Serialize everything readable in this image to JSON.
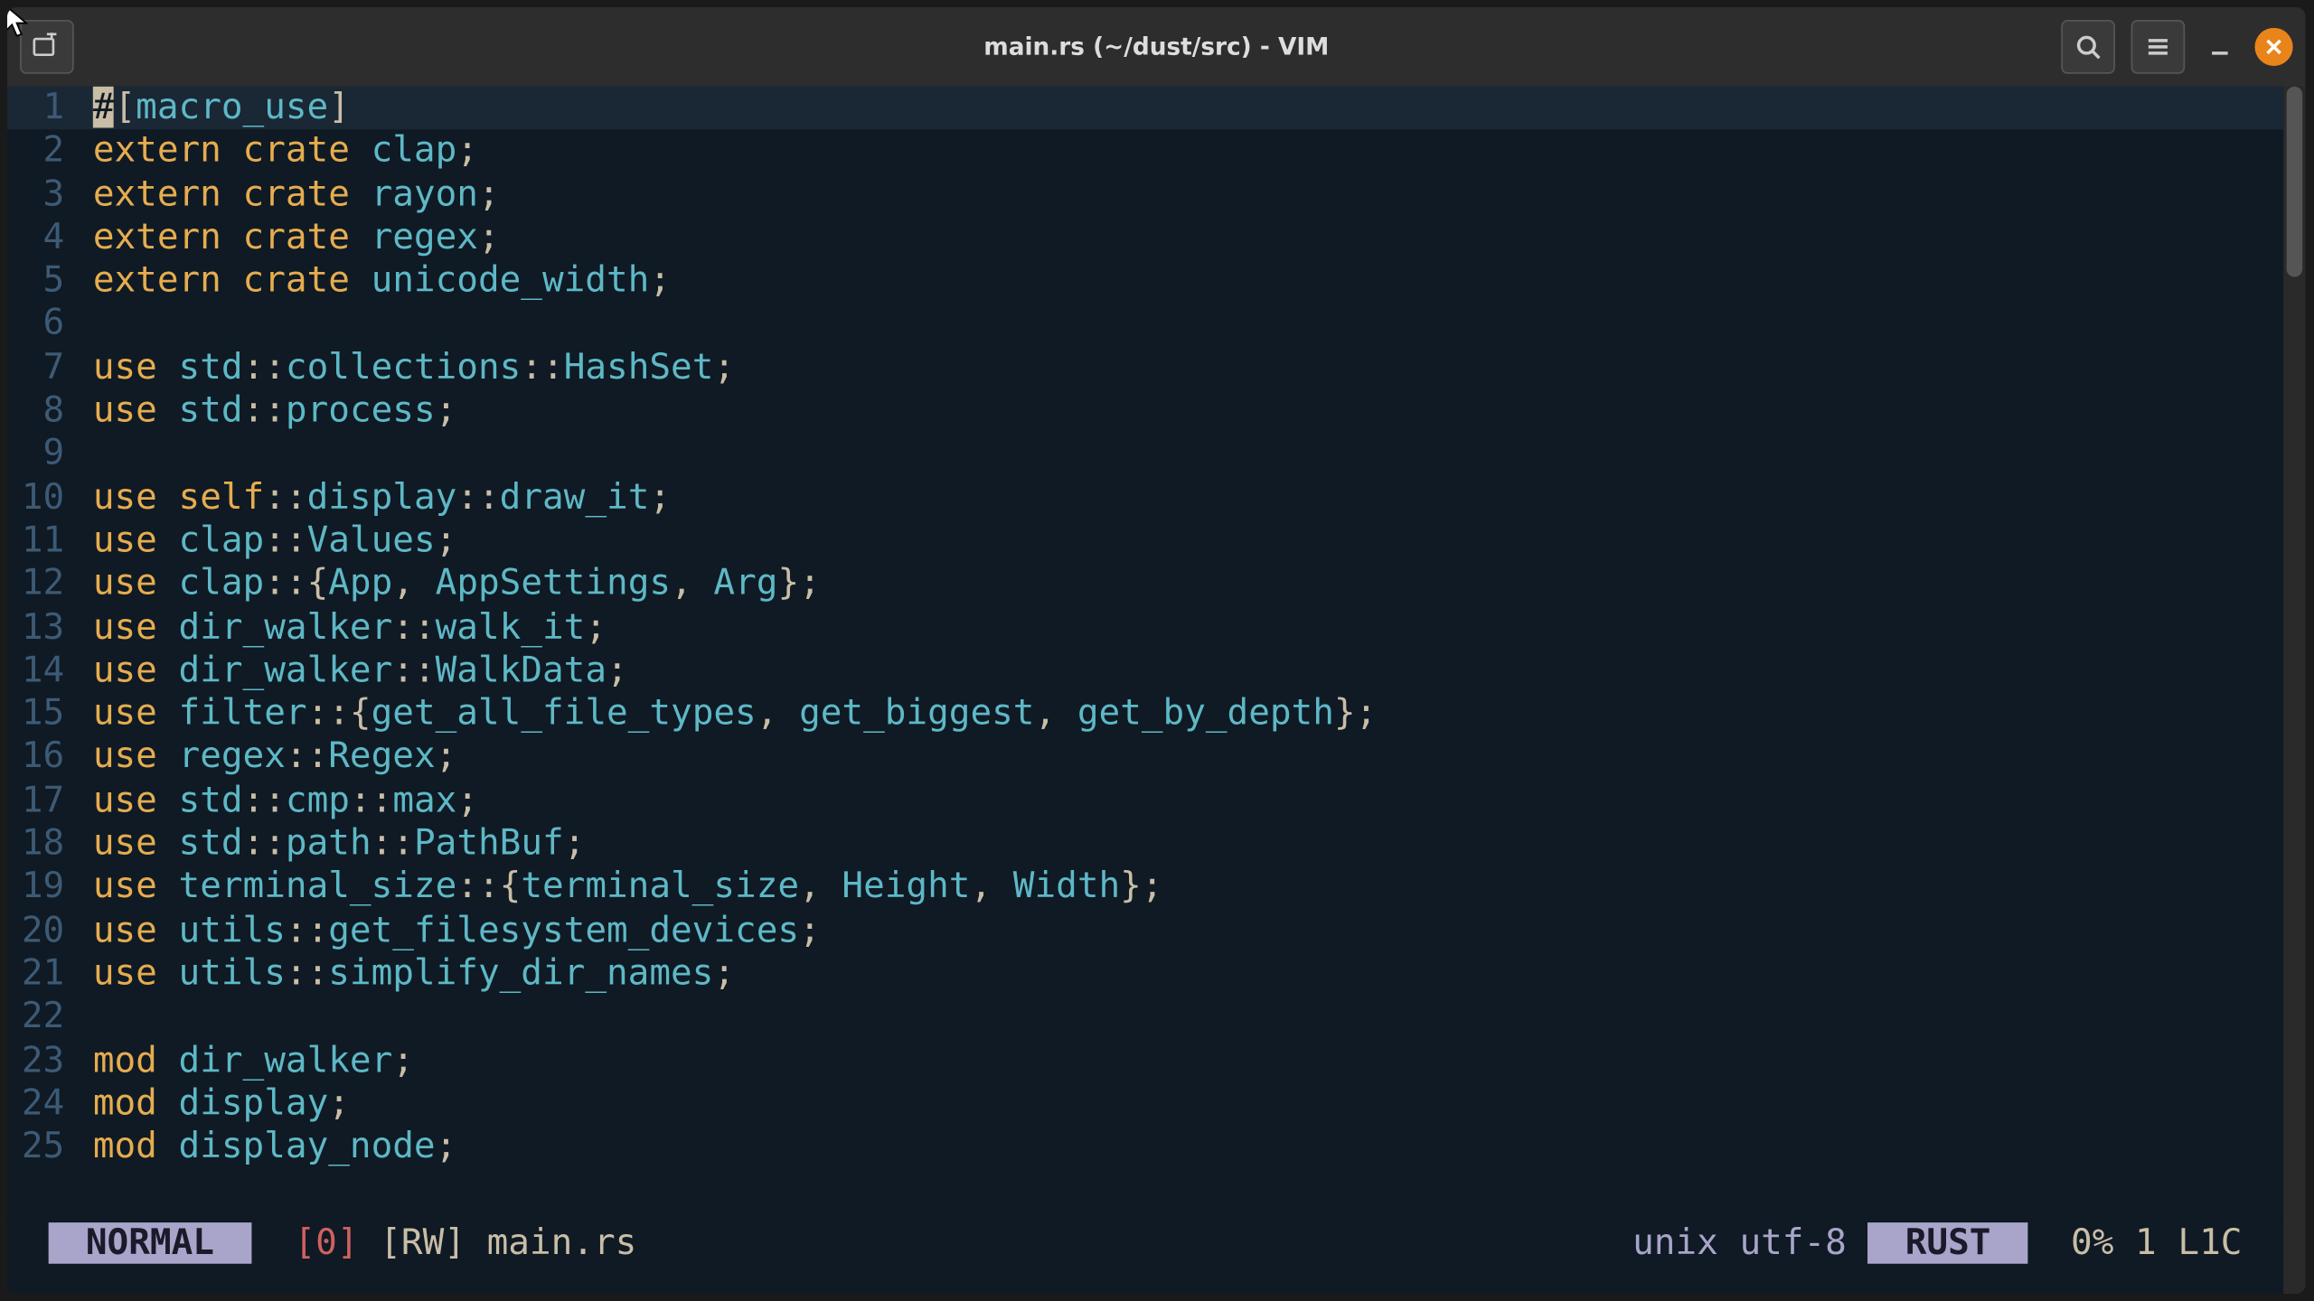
{
  "title": "main.rs (~/dust/src) - VIM",
  "code": {
    "lines": [
      {
        "n": 1,
        "tokens": [
          {
            "t": "#",
            "c": "cursor-block"
          },
          {
            "t": "[",
            "c": "t-punc"
          },
          {
            "t": "macro_use",
            "c": "t-id"
          },
          {
            "t": "]",
            "c": "t-punc"
          }
        ],
        "current": true
      },
      {
        "n": 2,
        "tokens": [
          {
            "t": "extern",
            "c": "t-kw"
          },
          {
            "t": " ",
            "c": ""
          },
          {
            "t": "crate",
            "c": "t-kw"
          },
          {
            "t": " ",
            "c": ""
          },
          {
            "t": "clap",
            "c": "t-id"
          },
          {
            "t": ";",
            "c": "t-punc"
          }
        ]
      },
      {
        "n": 3,
        "tokens": [
          {
            "t": "extern",
            "c": "t-kw"
          },
          {
            "t": " ",
            "c": ""
          },
          {
            "t": "crate",
            "c": "t-kw"
          },
          {
            "t": " ",
            "c": ""
          },
          {
            "t": "rayon",
            "c": "t-id"
          },
          {
            "t": ";",
            "c": "t-punc"
          }
        ]
      },
      {
        "n": 4,
        "tokens": [
          {
            "t": "extern",
            "c": "t-kw"
          },
          {
            "t": " ",
            "c": ""
          },
          {
            "t": "crate",
            "c": "t-kw"
          },
          {
            "t": " ",
            "c": ""
          },
          {
            "t": "regex",
            "c": "t-id"
          },
          {
            "t": ";",
            "c": "t-punc"
          }
        ]
      },
      {
        "n": 5,
        "tokens": [
          {
            "t": "extern",
            "c": "t-kw"
          },
          {
            "t": " ",
            "c": ""
          },
          {
            "t": "crate",
            "c": "t-kw"
          },
          {
            "t": " ",
            "c": ""
          },
          {
            "t": "unicode_width",
            "c": "t-id"
          },
          {
            "t": ";",
            "c": "t-punc"
          }
        ]
      },
      {
        "n": 6,
        "tokens": []
      },
      {
        "n": 7,
        "tokens": [
          {
            "t": "use",
            "c": "t-kw"
          },
          {
            "t": " ",
            "c": ""
          },
          {
            "t": "std",
            "c": "t-id"
          },
          {
            "t": "::",
            "c": "t-punc"
          },
          {
            "t": "collections",
            "c": "t-id"
          },
          {
            "t": "::",
            "c": "t-punc"
          },
          {
            "t": "HashSet",
            "c": "t-id"
          },
          {
            "t": ";",
            "c": "t-punc"
          }
        ]
      },
      {
        "n": 8,
        "tokens": [
          {
            "t": "use",
            "c": "t-kw"
          },
          {
            "t": " ",
            "c": ""
          },
          {
            "t": "std",
            "c": "t-id"
          },
          {
            "t": "::",
            "c": "t-punc"
          },
          {
            "t": "process",
            "c": "t-id"
          },
          {
            "t": ";",
            "c": "t-punc"
          }
        ]
      },
      {
        "n": 9,
        "tokens": []
      },
      {
        "n": 10,
        "tokens": [
          {
            "t": "use",
            "c": "t-kw"
          },
          {
            "t": " ",
            "c": ""
          },
          {
            "t": "self",
            "c": "t-kw"
          },
          {
            "t": "::",
            "c": "t-punc"
          },
          {
            "t": "display",
            "c": "t-id"
          },
          {
            "t": "::",
            "c": "t-punc"
          },
          {
            "t": "draw_it",
            "c": "t-id"
          },
          {
            "t": ";",
            "c": "t-punc"
          }
        ]
      },
      {
        "n": 11,
        "tokens": [
          {
            "t": "use",
            "c": "t-kw"
          },
          {
            "t": " ",
            "c": ""
          },
          {
            "t": "clap",
            "c": "t-id"
          },
          {
            "t": "::",
            "c": "t-punc"
          },
          {
            "t": "Values",
            "c": "t-id"
          },
          {
            "t": ";",
            "c": "t-punc"
          }
        ]
      },
      {
        "n": 12,
        "tokens": [
          {
            "t": "use",
            "c": "t-kw"
          },
          {
            "t": " ",
            "c": ""
          },
          {
            "t": "clap",
            "c": "t-id"
          },
          {
            "t": "::{",
            "c": "t-punc"
          },
          {
            "t": "App",
            "c": "t-id"
          },
          {
            "t": ", ",
            "c": "t-punc"
          },
          {
            "t": "AppSettings",
            "c": "t-id"
          },
          {
            "t": ", ",
            "c": "t-punc"
          },
          {
            "t": "Arg",
            "c": "t-id"
          },
          {
            "t": "};",
            "c": "t-punc"
          }
        ]
      },
      {
        "n": 13,
        "tokens": [
          {
            "t": "use",
            "c": "t-kw"
          },
          {
            "t": " ",
            "c": ""
          },
          {
            "t": "dir_walker",
            "c": "t-id"
          },
          {
            "t": "::",
            "c": "t-punc"
          },
          {
            "t": "walk_it",
            "c": "t-id"
          },
          {
            "t": ";",
            "c": "t-punc"
          }
        ]
      },
      {
        "n": 14,
        "tokens": [
          {
            "t": "use",
            "c": "t-kw"
          },
          {
            "t": " ",
            "c": ""
          },
          {
            "t": "dir_walker",
            "c": "t-id"
          },
          {
            "t": "::",
            "c": "t-punc"
          },
          {
            "t": "WalkData",
            "c": "t-id"
          },
          {
            "t": ";",
            "c": "t-punc"
          }
        ]
      },
      {
        "n": 15,
        "tokens": [
          {
            "t": "use",
            "c": "t-kw"
          },
          {
            "t": " ",
            "c": ""
          },
          {
            "t": "filter",
            "c": "t-id"
          },
          {
            "t": "::{",
            "c": "t-punc"
          },
          {
            "t": "get_all_file_types",
            "c": "t-id"
          },
          {
            "t": ", ",
            "c": "t-punc"
          },
          {
            "t": "get_biggest",
            "c": "t-id"
          },
          {
            "t": ", ",
            "c": "t-punc"
          },
          {
            "t": "get_by_depth",
            "c": "t-id"
          },
          {
            "t": "};",
            "c": "t-punc"
          }
        ]
      },
      {
        "n": 16,
        "tokens": [
          {
            "t": "use",
            "c": "t-kw"
          },
          {
            "t": " ",
            "c": ""
          },
          {
            "t": "regex",
            "c": "t-id"
          },
          {
            "t": "::",
            "c": "t-punc"
          },
          {
            "t": "Regex",
            "c": "t-id"
          },
          {
            "t": ";",
            "c": "t-punc"
          }
        ]
      },
      {
        "n": 17,
        "tokens": [
          {
            "t": "use",
            "c": "t-kw"
          },
          {
            "t": " ",
            "c": ""
          },
          {
            "t": "std",
            "c": "t-id"
          },
          {
            "t": "::",
            "c": "t-punc"
          },
          {
            "t": "cmp",
            "c": "t-id"
          },
          {
            "t": "::",
            "c": "t-punc"
          },
          {
            "t": "max",
            "c": "t-id"
          },
          {
            "t": ";",
            "c": "t-punc"
          }
        ]
      },
      {
        "n": 18,
        "tokens": [
          {
            "t": "use",
            "c": "t-kw"
          },
          {
            "t": " ",
            "c": ""
          },
          {
            "t": "std",
            "c": "t-id"
          },
          {
            "t": "::",
            "c": "t-punc"
          },
          {
            "t": "path",
            "c": "t-id"
          },
          {
            "t": "::",
            "c": "t-punc"
          },
          {
            "t": "PathBuf",
            "c": "t-id"
          },
          {
            "t": ";",
            "c": "t-punc"
          }
        ]
      },
      {
        "n": 19,
        "tokens": [
          {
            "t": "use",
            "c": "t-kw"
          },
          {
            "t": " ",
            "c": ""
          },
          {
            "t": "terminal_size",
            "c": "t-id"
          },
          {
            "t": "::{",
            "c": "t-punc"
          },
          {
            "t": "terminal_size",
            "c": "t-id"
          },
          {
            "t": ", ",
            "c": "t-punc"
          },
          {
            "t": "Height",
            "c": "t-id"
          },
          {
            "t": ", ",
            "c": "t-punc"
          },
          {
            "t": "Width",
            "c": "t-id"
          },
          {
            "t": "};",
            "c": "t-punc"
          }
        ]
      },
      {
        "n": 20,
        "tokens": [
          {
            "t": "use",
            "c": "t-kw"
          },
          {
            "t": " ",
            "c": ""
          },
          {
            "t": "utils",
            "c": "t-id"
          },
          {
            "t": "::",
            "c": "t-punc"
          },
          {
            "t": "get_filesystem_devices",
            "c": "t-id"
          },
          {
            "t": ";",
            "c": "t-punc"
          }
        ]
      },
      {
        "n": 21,
        "tokens": [
          {
            "t": "use",
            "c": "t-kw"
          },
          {
            "t": " ",
            "c": ""
          },
          {
            "t": "utils",
            "c": "t-id"
          },
          {
            "t": "::",
            "c": "t-punc"
          },
          {
            "t": "simplify_dir_names",
            "c": "t-id"
          },
          {
            "t": ";",
            "c": "t-punc"
          }
        ]
      },
      {
        "n": 22,
        "tokens": []
      },
      {
        "n": 23,
        "tokens": [
          {
            "t": "mod",
            "c": "t-kw"
          },
          {
            "t": " ",
            "c": ""
          },
          {
            "t": "dir_walker",
            "c": "t-id"
          },
          {
            "t": ";",
            "c": "t-punc"
          }
        ]
      },
      {
        "n": 24,
        "tokens": [
          {
            "t": "mod",
            "c": "t-kw"
          },
          {
            "t": " ",
            "c": ""
          },
          {
            "t": "display",
            "c": "t-id"
          },
          {
            "t": ";",
            "c": "t-punc"
          }
        ]
      },
      {
        "n": 25,
        "tokens": [
          {
            "t": "mod",
            "c": "t-kw"
          },
          {
            "t": " ",
            "c": ""
          },
          {
            "t": "display_node",
            "c": "t-id"
          },
          {
            "t": ";",
            "c": "t-punc"
          }
        ]
      }
    ]
  },
  "status": {
    "mode": " NORMAL ",
    "zero": "[0]",
    "rw": "[RW]",
    "file": "main.rs",
    "fileformat": "unix",
    "encoding": "utf-8",
    "lang": " RUST ",
    "percent": "0%",
    "lineno": "1",
    "col": "L1C"
  }
}
